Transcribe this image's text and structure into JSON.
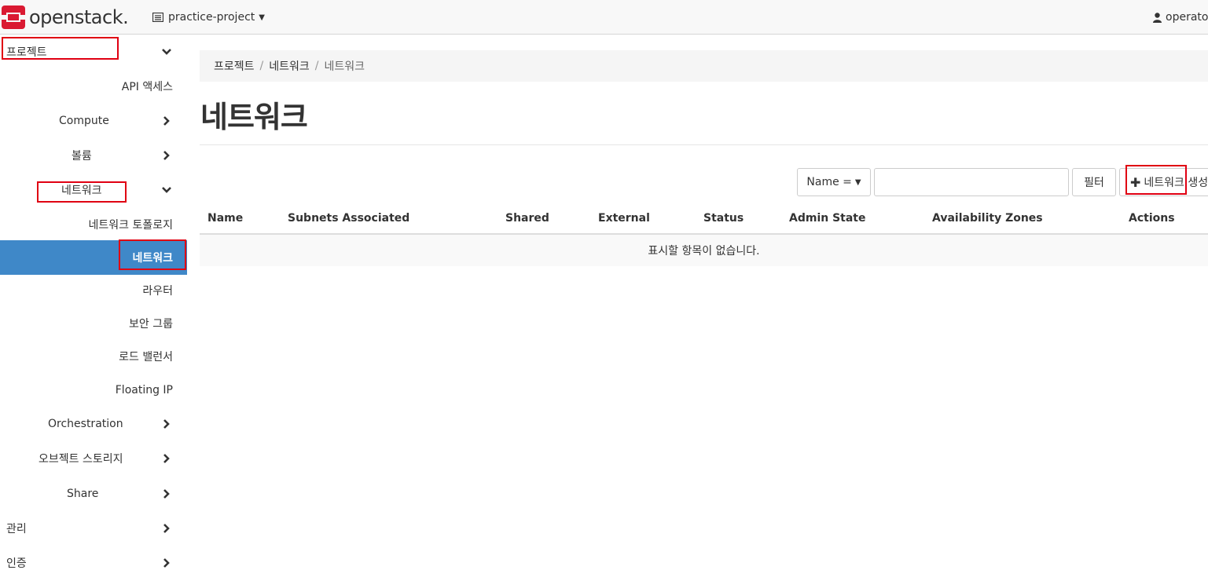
{
  "brand": {
    "name": "openstack",
    "dot": ".",
    "color": "#da1a32"
  },
  "header": {
    "project": "practice-project",
    "user": "operator",
    "project_icon": "server-list-icon",
    "user_icon": "user-icon"
  },
  "sidebar": {
    "items": [
      {
        "label": "프로젝트",
        "chevron": "down"
      },
      {
        "label": "API 액세스"
      },
      {
        "label": "Compute",
        "chevron": "right"
      },
      {
        "label": "볼륨",
        "chevron": "right"
      },
      {
        "label": "네트워크",
        "chevron": "down"
      },
      {
        "label": "네트워크 토폴로지"
      },
      {
        "label": "네트워크",
        "active": true
      },
      {
        "label": "라우터"
      },
      {
        "label": "보안 그룹"
      },
      {
        "label": "로드 밸런서"
      },
      {
        "label": "Floating IP"
      },
      {
        "label": "Orchestration",
        "chevron": "right"
      },
      {
        "label": "오브젝트 스토리지",
        "chevron": "right"
      },
      {
        "label": "Share",
        "chevron": "right"
      },
      {
        "label": "관리",
        "chevron": "right"
      },
      {
        "label": "인증",
        "chevron": "right"
      }
    ],
    "active_color": "#3f88c8"
  },
  "breadcrumb": [
    "프로젝트",
    "네트워크",
    "네트워크"
  ],
  "page": {
    "title": "네트워크"
  },
  "toolbar": {
    "filter_field": "Name =",
    "filter_value": "",
    "filter_button": "필터",
    "create_button": "네트워크 생성"
  },
  "table": {
    "columns": [
      "Name",
      "Subnets Associated",
      "Shared",
      "External",
      "Status",
      "Admin State",
      "Availability Zones",
      "Actions"
    ],
    "empty_message": "표시할 항목이 없습니다."
  },
  "highlight_color": "#e00012"
}
